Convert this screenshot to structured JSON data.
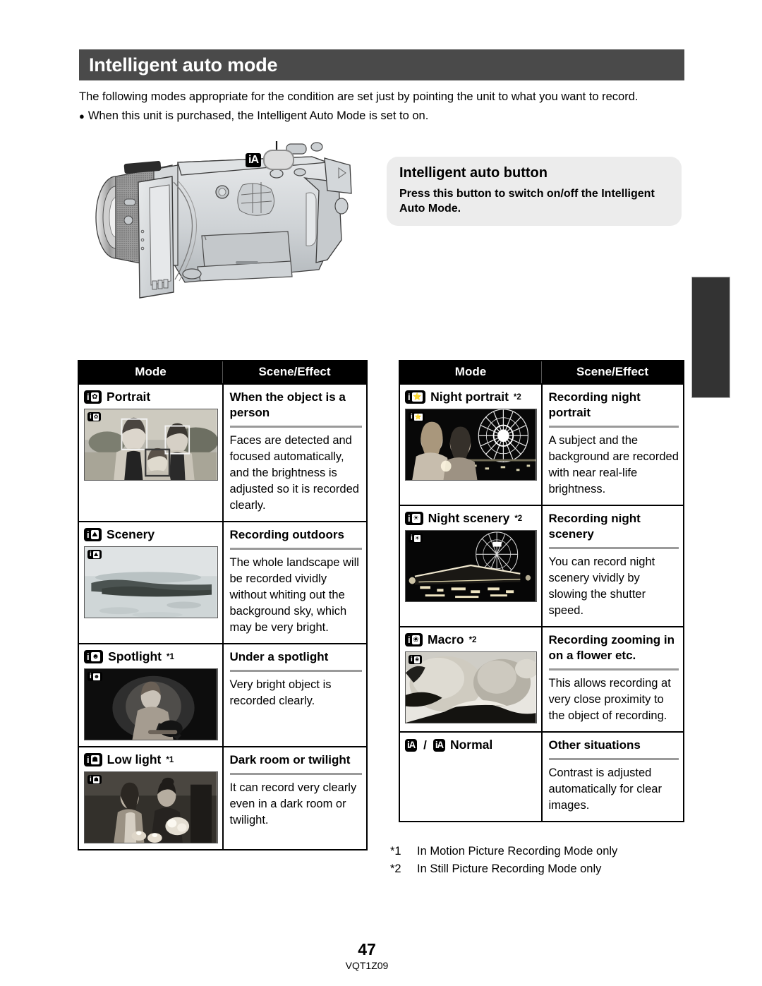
{
  "header": {
    "title": "Intelligent auto mode"
  },
  "intro": {
    "paragraph": "The following modes appropriate for the condition are set just by pointing the unit to what you want to record.",
    "bullet_dot": "●",
    "bullet": "When this unit is purchased, the Intelligent Auto Mode is set to on."
  },
  "ia_button_callout": {
    "badge": "iA",
    "oval_label": ""
  },
  "callout": {
    "title": "Intelligent auto button",
    "body": "Press this button to switch on/off the Intelligent Auto Mode."
  },
  "tables": {
    "columns": {
      "mode": "Mode",
      "effect": "Scene/Effect"
    },
    "left_rows": [
      {
        "icon": {
          "i": "i",
          "glyph": "✿"
        },
        "mode": "Portrait",
        "note": "",
        "thumb_osd": {
          "i": "i",
          "glyph": "✿"
        },
        "thumb": "portrait-photo-three-people",
        "effect_title": "When the object is a person",
        "effect_body": "Faces are detected and focused automatically, and the brightness is adjusted so it is recorded clearly."
      },
      {
        "icon": {
          "i": "i",
          "glyph": "⛰"
        },
        "mode": "Scenery",
        "note": "",
        "thumb_osd": {
          "i": "i",
          "glyph": "⛰"
        },
        "thumb": "scenery-photo-coastline",
        "effect_title": "Recording outdoors",
        "effect_body": "The whole landscape will be recorded vividly without whiting out the background sky, which may be very bright."
      },
      {
        "icon": {
          "i": "i",
          "glyph": "☻"
        },
        "mode": "Spotlight",
        "note": "*1",
        "thumb_osd": {
          "i": "i",
          "glyph": "☻"
        },
        "thumb": "spotlight-photo-guitarist",
        "effect_title": "Under a spotlight",
        "effect_body": "Very bright object is recorded clearly."
      },
      {
        "icon": {
          "i": "i",
          "glyph": "☗"
        },
        "mode": "Low light",
        "note": "*1",
        "thumb_osd": {
          "i": "i",
          "glyph": "☗"
        },
        "thumb": "low-light-photo-two-women-candles",
        "effect_title": "Dark room or twilight",
        "effect_body": "It can record very clearly even in a dark room or twilight."
      }
    ],
    "right_rows": [
      {
        "icon": {
          "i": "i",
          "glyph": "⭐"
        },
        "mode": "Night portrait",
        "note": "*2",
        "thumb_osd": {
          "i": "i",
          "glyph": "⭐"
        },
        "thumb": "night-portrait-photo-ferris-wheel",
        "effect_title": "Recording night portrait",
        "effect_body": "A subject and the background are recorded with near real-life brightness."
      },
      {
        "icon": {
          "i": "i",
          "glyph": "☀"
        },
        "mode": "Night scenery",
        "note": "*2",
        "thumb_osd": {
          "i": "i",
          "glyph": "☀"
        },
        "thumb": "night-scenery-photo-illuminated-city",
        "effect_title": "Recording night scenery",
        "effect_body": "You can record night scenery vividly by slowing the shutter speed."
      },
      {
        "icon": {
          "i": "i",
          "glyph": "❀"
        },
        "mode": "Macro",
        "note": "*2",
        "thumb_osd": {
          "i": "i",
          "glyph": "❀"
        },
        "thumb": "macro-photo-peppers",
        "effect_title": "Recording zooming in on a flower etc.",
        "effect_body": "This allows recording at very close proximity to the object of recording."
      },
      {
        "icon_pair": {
          "first": "iA",
          "separator": "/",
          "second": "iA"
        },
        "mode": "Normal",
        "note": "",
        "thumb": "",
        "effect_title": "Other situations",
        "effect_body": "Contrast is adjusted automatically for clear images."
      }
    ]
  },
  "footnotes": [
    {
      "mark": "*1",
      "text": "In Motion Picture Recording Mode only"
    },
    {
      "mark": "*2",
      "text": "In Still Picture Recording Mode only"
    }
  ],
  "footer": {
    "page_number": "47",
    "doc_code": "VQT1Z09"
  },
  "colors": {
    "header_bar": "#4a4a4a",
    "callout_bg": "#ececec",
    "table_header": "#000000",
    "edge_tab": "#333333",
    "rule": "#9a9a9a"
  }
}
